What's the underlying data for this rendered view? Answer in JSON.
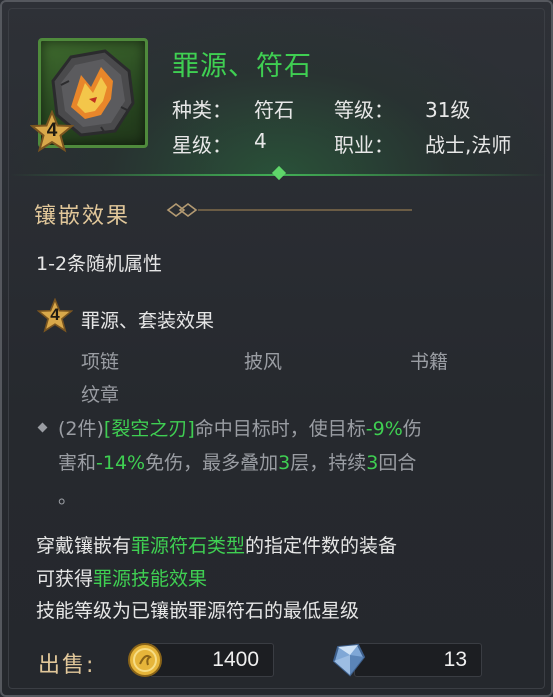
{
  "item": {
    "name": "罪源、符石",
    "icon": "runestone-wolf-icon",
    "star": "4",
    "type_label": "种类：",
    "type_value": "符石",
    "level_label": "等级：",
    "level_value": "31级",
    "star_label": "星级：",
    "star_value": "4",
    "class_label": "职业：",
    "class_value": "战士,法师"
  },
  "inlay": {
    "title": "镶嵌效果",
    "random_attr": "1-2条随机属性",
    "set_star": "4",
    "set_title": "罪源、套装效果",
    "set_pieces": [
      "项链",
      "披风",
      "书籍",
      "纹章"
    ],
    "effect": {
      "p1": "(2件)",
      "p2": "[裂空之刃]",
      "p3": "命中目标时，使目标",
      "p4": "-9%",
      "p5": "伤",
      "p6": "害和",
      "p7": "-14%",
      "p8": "免伤，最多叠加",
      "p9": "3",
      "p10": "层，持续",
      "p11": "3",
      "p12": "回合",
      "p13": "。"
    },
    "note": {
      "a1": "穿戴镶嵌有",
      "a2": "罪源符石类型",
      "a3": "的指定件数的装备",
      "b1": "可获得",
      "b2": "罪源技能效果",
      "c": "技能等级为已镶嵌罪源符石的最低星级"
    }
  },
  "sell": {
    "label": "出售:",
    "gold_icon": "gold-coin-icon",
    "gold": "1400",
    "gem_icon": "diamond-icon",
    "gem": "13"
  },
  "colors": {
    "title_green": "#3fcf52",
    "gold_text": "#e1c79a",
    "grey_text": "#9a9da3"
  }
}
